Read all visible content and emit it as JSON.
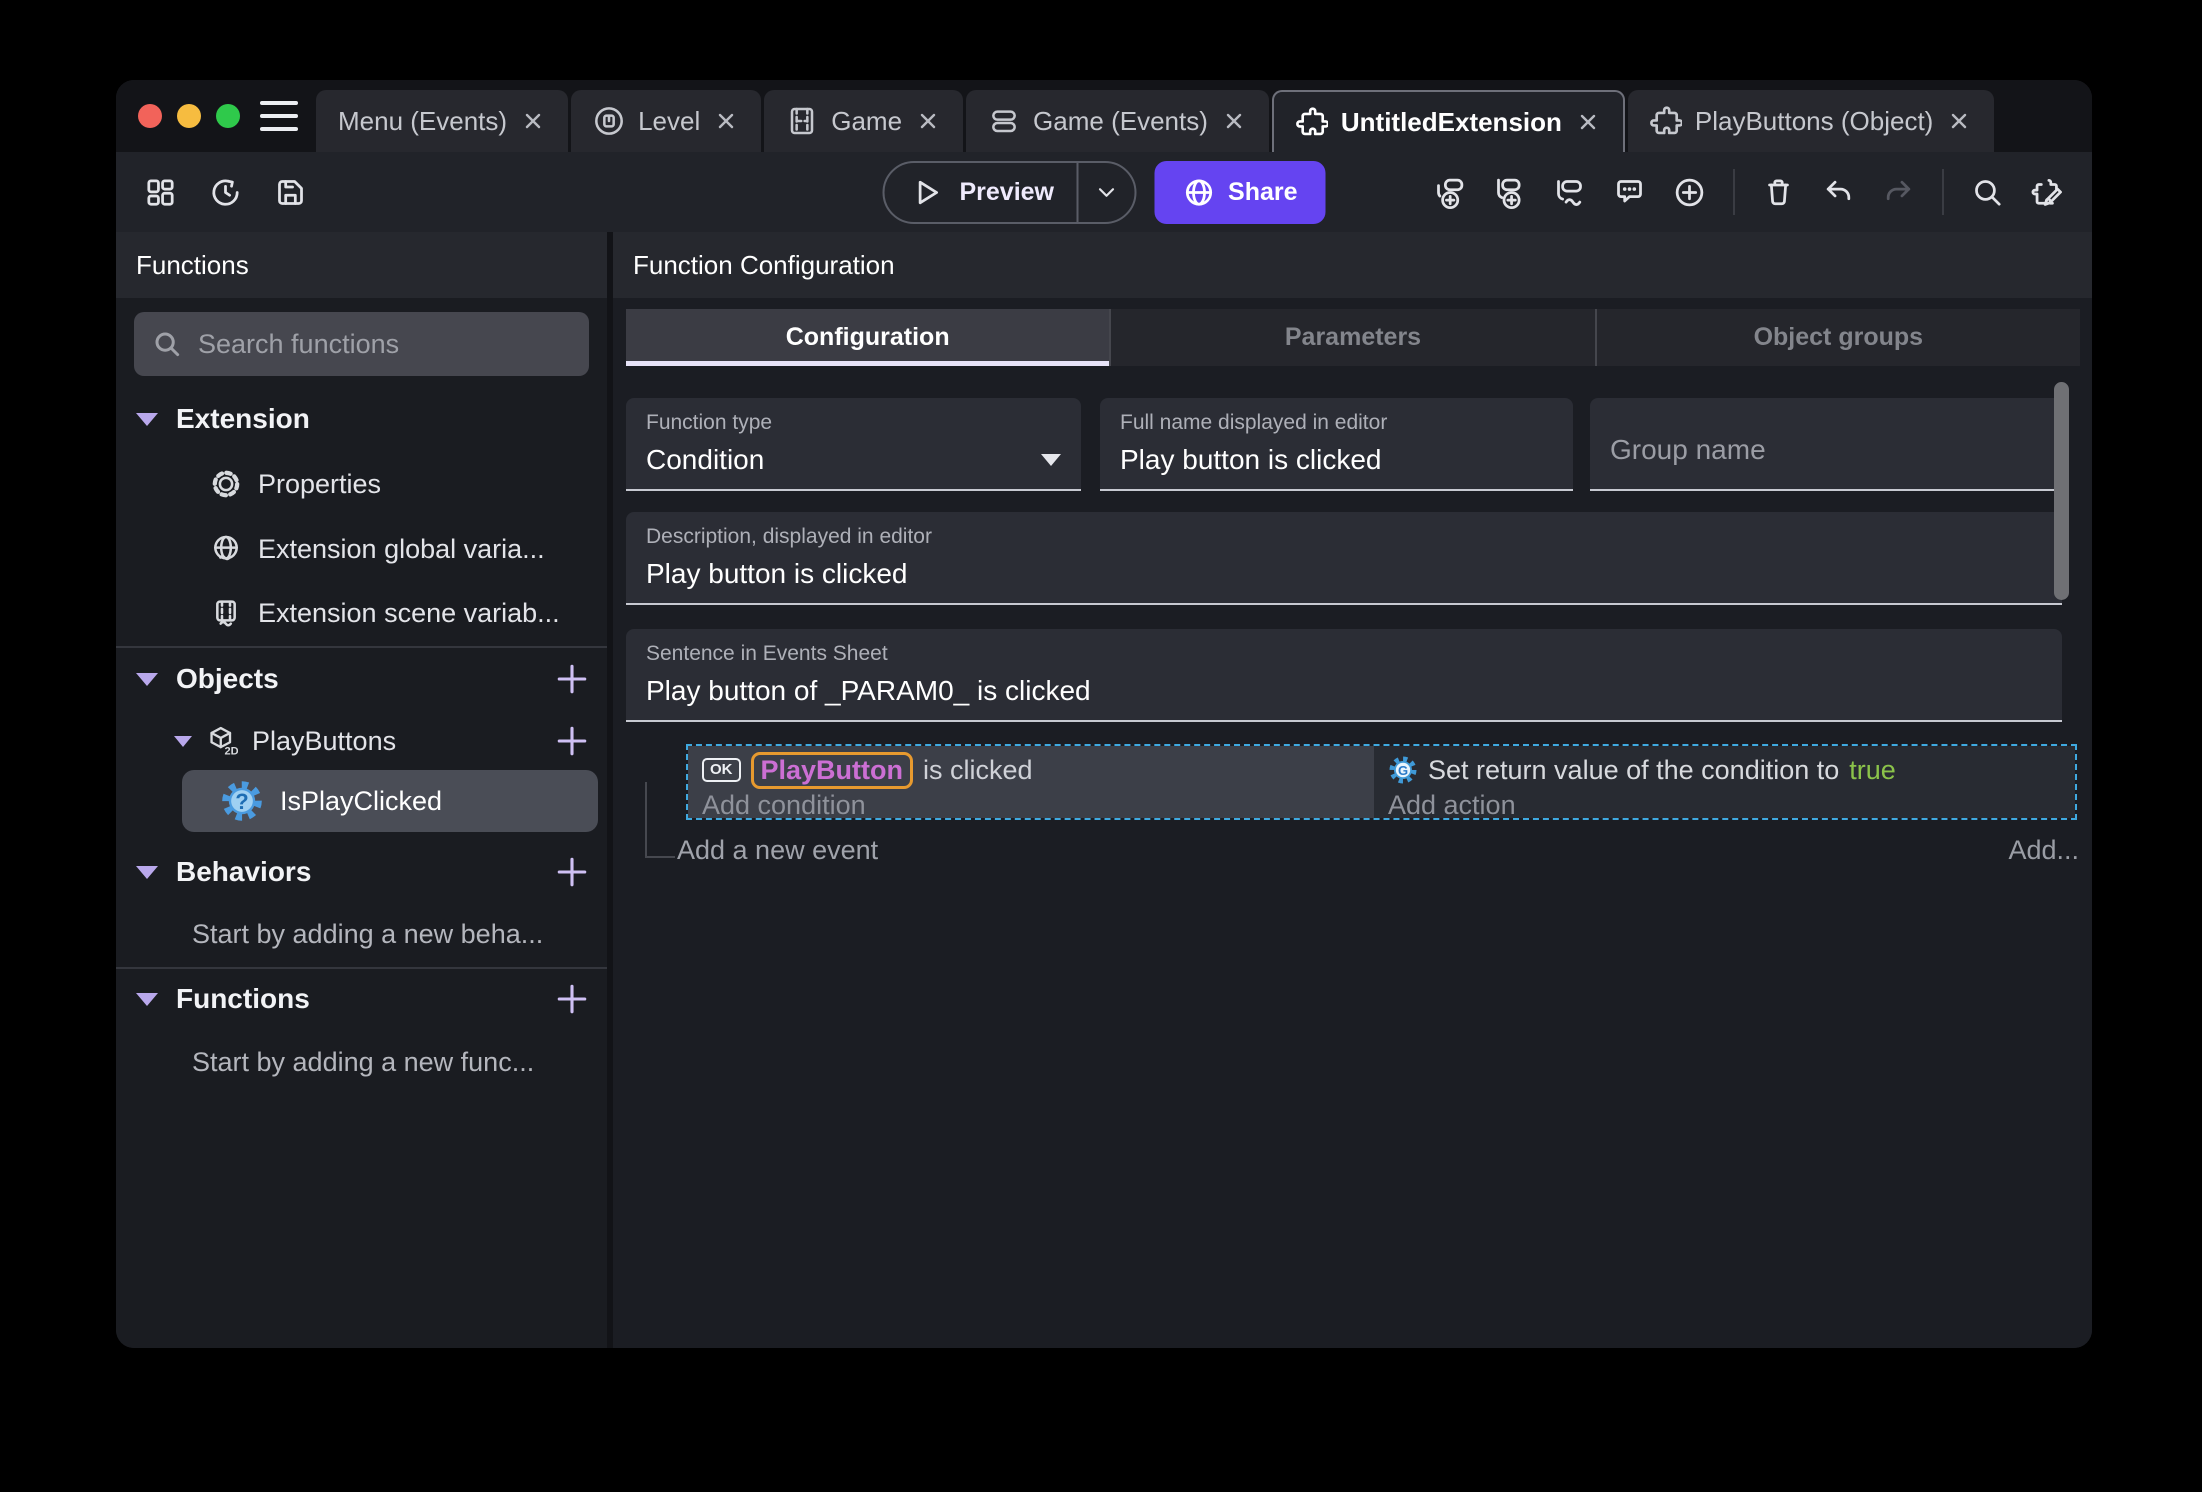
{
  "colors": {
    "accent_purple": "#6544f1",
    "selection_blue": "#3fa9e0",
    "object_name_pink": "#cc6fd4",
    "object_highlight_orange": "#e79a2f",
    "boolean_true_green": "#8bc34a",
    "icon_gear_blue": "#4a9be0"
  },
  "titlebar": {
    "tabs": [
      {
        "label": "Menu (Events)"
      },
      {
        "label": "Level"
      },
      {
        "label": "Game"
      },
      {
        "label": "Game (Events)"
      },
      {
        "label": "UntitledExtension"
      },
      {
        "label": "PlayButtons (Object)"
      }
    ]
  },
  "toolbar": {
    "preview_label": "Preview",
    "share_label": "Share"
  },
  "sidebar": {
    "title": "Functions",
    "search_placeholder": "Search functions",
    "extension_header": "Extension",
    "properties_label": "Properties",
    "global_vars_label": "Extension global varia...",
    "scene_vars_label": "Extension scene variab...",
    "objects_header": "Objects",
    "playbuttons_label": "PlayButtons",
    "cube_badge": "2D",
    "isplayclicked_label": "IsPlayClicked",
    "isplayclicked_glyph": "?",
    "behaviors_header": "Behaviors",
    "behaviors_hint": "Start by adding a new beha...",
    "functions_header": "Functions",
    "functions_hint": "Start by adding a new func..."
  },
  "main": {
    "title": "Function Configuration",
    "tab_configuration": "Configuration",
    "tab_parameters": "Parameters",
    "tab_object_groups": "Object groups",
    "fields": {
      "function_type_label": "Function type",
      "function_type_value": "Condition",
      "full_name_label": "Full name displayed in editor",
      "full_name_value": "Play button is clicked",
      "group_name_placeholder": "Group name",
      "description_label": "Description, displayed in editor",
      "description_value": "Play button is clicked",
      "sentence_label": "Sentence in Events Sheet",
      "sentence_value": "Play button of _PARAM0_ is clicked"
    },
    "event": {
      "object_chip": "OK",
      "object_name": "PlayButton",
      "condition_suffix": "is clicked",
      "add_condition": "Add condition",
      "action_prefix": "Set return value of the condition to",
      "action_value": "true",
      "action_glyph": "G",
      "add_action": "Add action"
    },
    "add_event_label": "Add a new event",
    "add_more_label": "Add..."
  }
}
